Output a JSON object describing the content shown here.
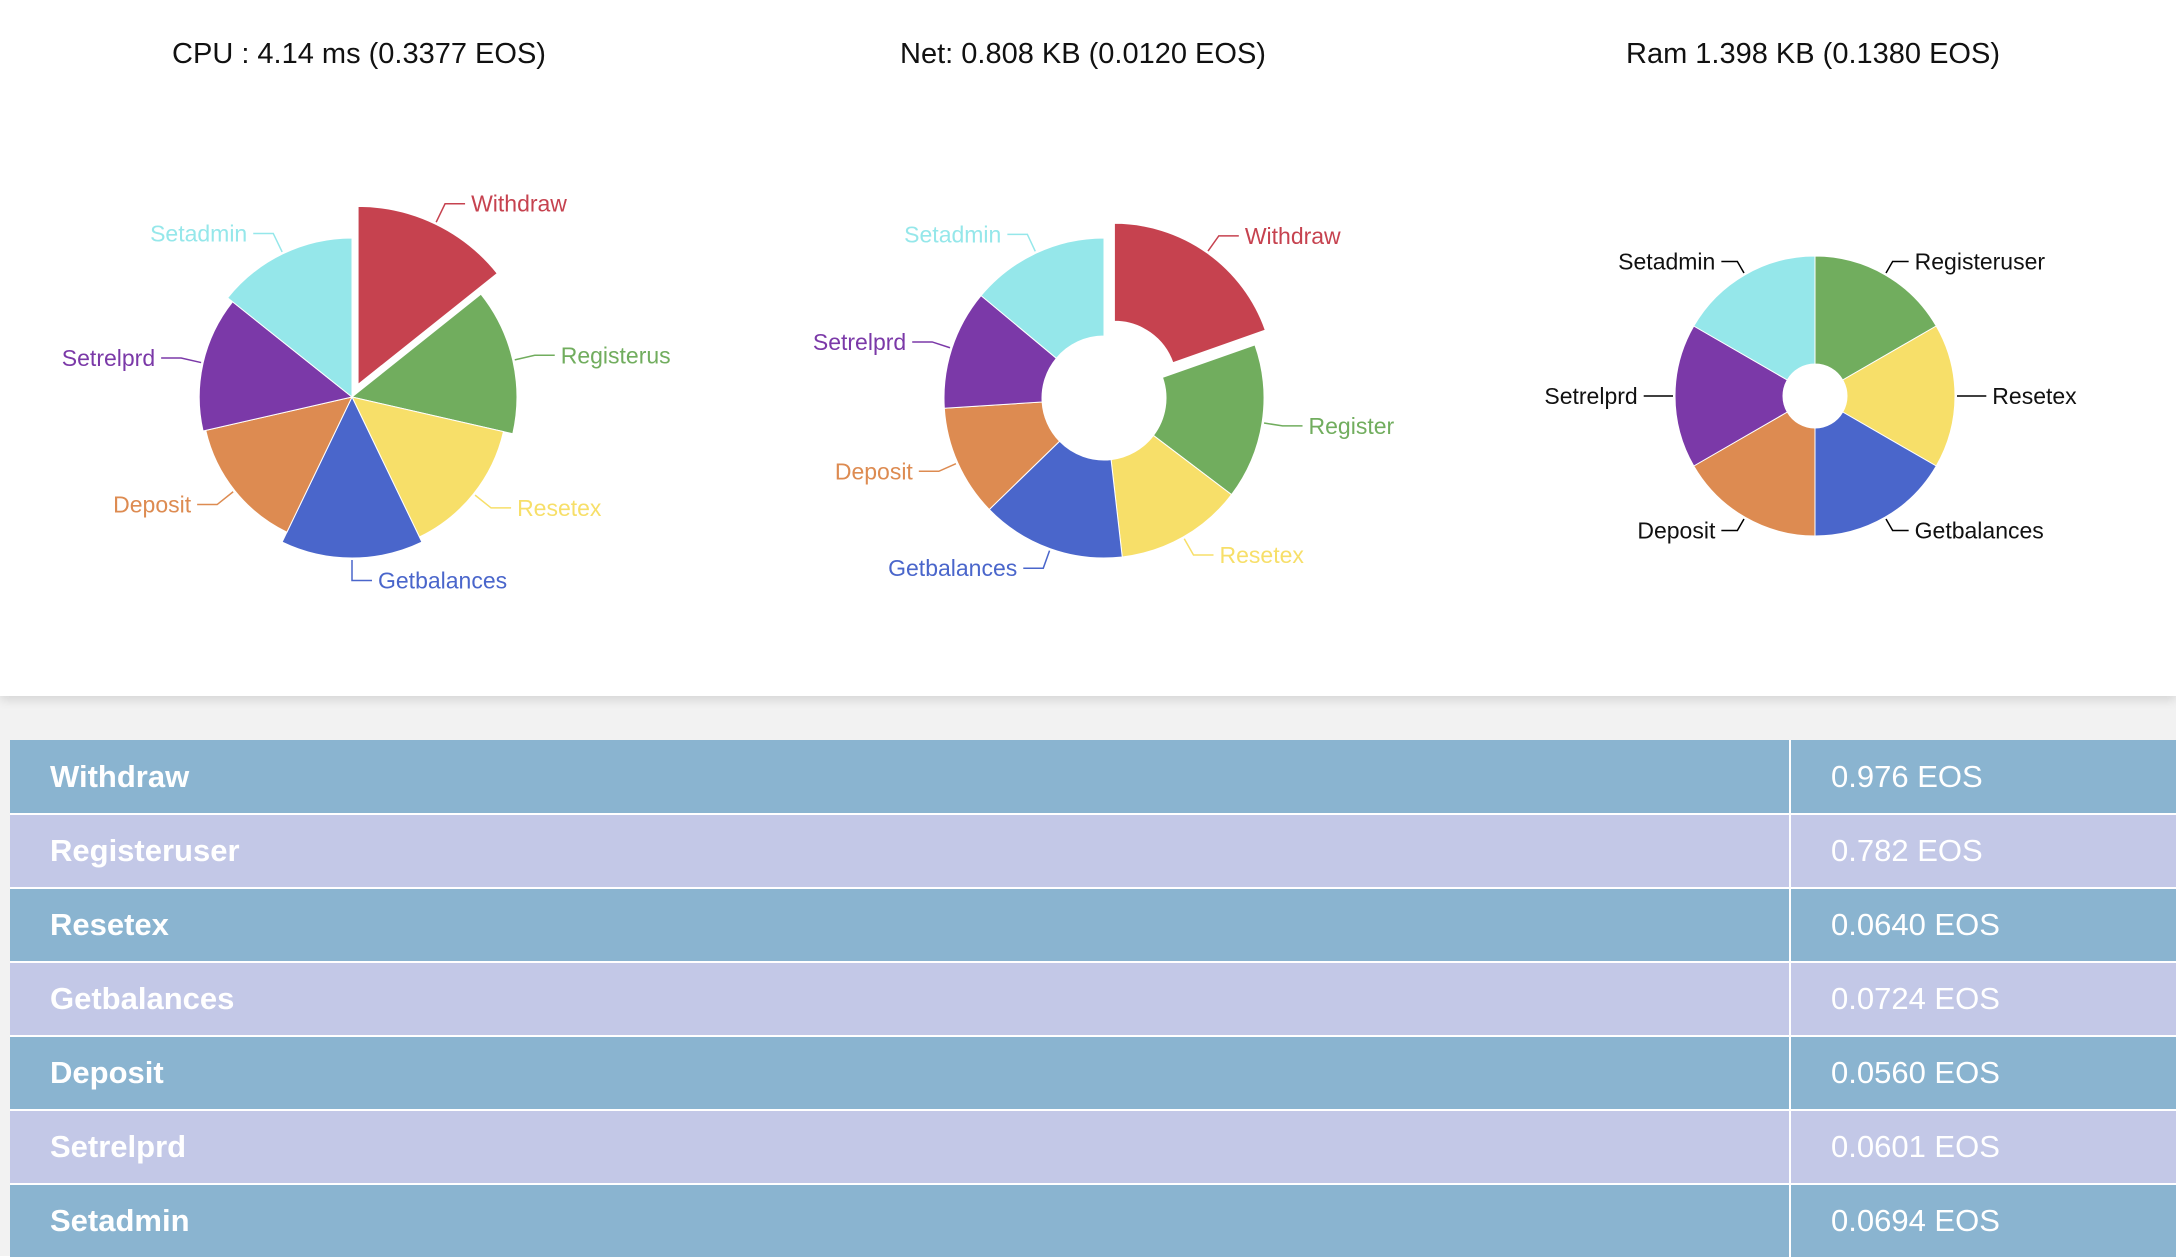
{
  "chart_data": [
    {
      "type": "pie",
      "title": "CPU : 4.14 ms (0.3377 EOS)",
      "variant": "rose",
      "categories": [
        "Withdraw",
        "Registerus",
        "Resetex",
        "Getbalances",
        "Deposit",
        "Setrelprd",
        "Setadmin"
      ],
      "values": [
        0.976,
        0.782,
        0.64,
        0.724,
        0.56,
        0.601,
        0.694
      ],
      "colors": [
        "#c6424f",
        "#71ad5e",
        "#f7df69",
        "#4a66cb",
        "#dd8b51",
        "#7b39a8",
        "#95e7ea"
      ],
      "exploded": "Withdraw",
      "label_style": "colored"
    },
    {
      "type": "pie",
      "title": "Net: 0.808 KB (0.0120 EOS)",
      "variant": "donut",
      "categories": [
        "Withdraw",
        "Register",
        "Resetex",
        "Getbalances",
        "Deposit",
        "Setrelprd",
        "Setadmin"
      ],
      "values": [
        0.976,
        0.782,
        0.64,
        0.724,
        0.56,
        0.601,
        0.694
      ],
      "colors": [
        "#c6424f",
        "#71ad5e",
        "#f7df69",
        "#4a66cb",
        "#dd8b51",
        "#7b39a8",
        "#95e7ea"
      ],
      "exploded": "Withdraw",
      "label_style": "colored"
    },
    {
      "type": "pie",
      "title": "Ram 1.398 KB (0.1380 EOS)",
      "variant": "donut-small-hole",
      "categories": [
        "Registeruser",
        "Resetex",
        "Getbalances",
        "Deposit",
        "Setrelprd",
        "Setadmin"
      ],
      "values": [
        1,
        1,
        1,
        1,
        1,
        1
      ],
      "colors": [
        "#71ad5e",
        "#f7df69",
        "#4a66cb",
        "#dd8b51",
        "#7b39a8",
        "#95e7ea"
      ],
      "label_style": "black"
    }
  ],
  "table": {
    "rows": [
      {
        "name": "Withdraw",
        "value": "0.976 EOS"
      },
      {
        "name": "Registeruser",
        "value": "0.782 EOS"
      },
      {
        "name": "Resetex",
        "value": "0.0640 EOS"
      },
      {
        "name": "Getbalances",
        "value": "0.0724 EOS"
      },
      {
        "name": "Deposit",
        "value": "0.0560 EOS"
      },
      {
        "name": "Setrelprd",
        "value": "0.0601 EOS"
      },
      {
        "name": "Setadmin",
        "value": "0.0694 EOS"
      }
    ]
  }
}
